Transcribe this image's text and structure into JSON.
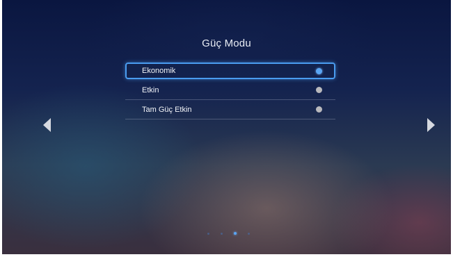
{
  "screen": {
    "title": "Güç Modu"
  },
  "menu": {
    "items": [
      {
        "label": "Ekonomik",
        "selected": true
      },
      {
        "label": "Etkin",
        "selected": false
      },
      {
        "label": "Tam Güç Etkin",
        "selected": false
      }
    ]
  },
  "navigation": {
    "left_icon": "triangle-left-icon",
    "right_icon": "triangle-right-icon"
  },
  "pager": {
    "page_count": 4,
    "current_page": 3
  },
  "colors": {
    "accent": "#4a9cf0",
    "radio_selected": "#5aa6f4",
    "radio_unselected": "#b9b9bd",
    "text": "#f2f4f8"
  }
}
